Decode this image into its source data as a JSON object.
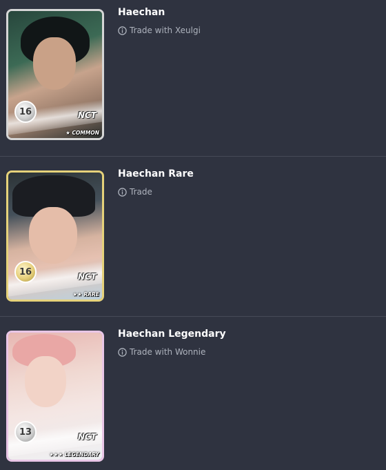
{
  "cards": [
    {
      "name": "Haechan",
      "subtitle": "Trade with Xeulgi",
      "level": "16",
      "group": "NCT",
      "rarity": "common",
      "rarity_label": "★ COMMON"
    },
    {
      "name": "Haechan Rare",
      "subtitle": "Trade",
      "level": "16",
      "group": "NCT",
      "rarity": "rare",
      "rarity_label": "★★ RARE"
    },
    {
      "name": "Haechan Legendary",
      "subtitle": "Trade with Wonnie",
      "level": "13",
      "group": "NCT",
      "rarity": "legendary",
      "rarity_label": "★★★ LEGENDARY"
    }
  ],
  "icons": {
    "info": "info-circle-icon"
  },
  "colors": {
    "background": "#2f3340",
    "divider": "#464b58",
    "title": "#ffffff",
    "subtitle": "#aeb3bd"
  }
}
